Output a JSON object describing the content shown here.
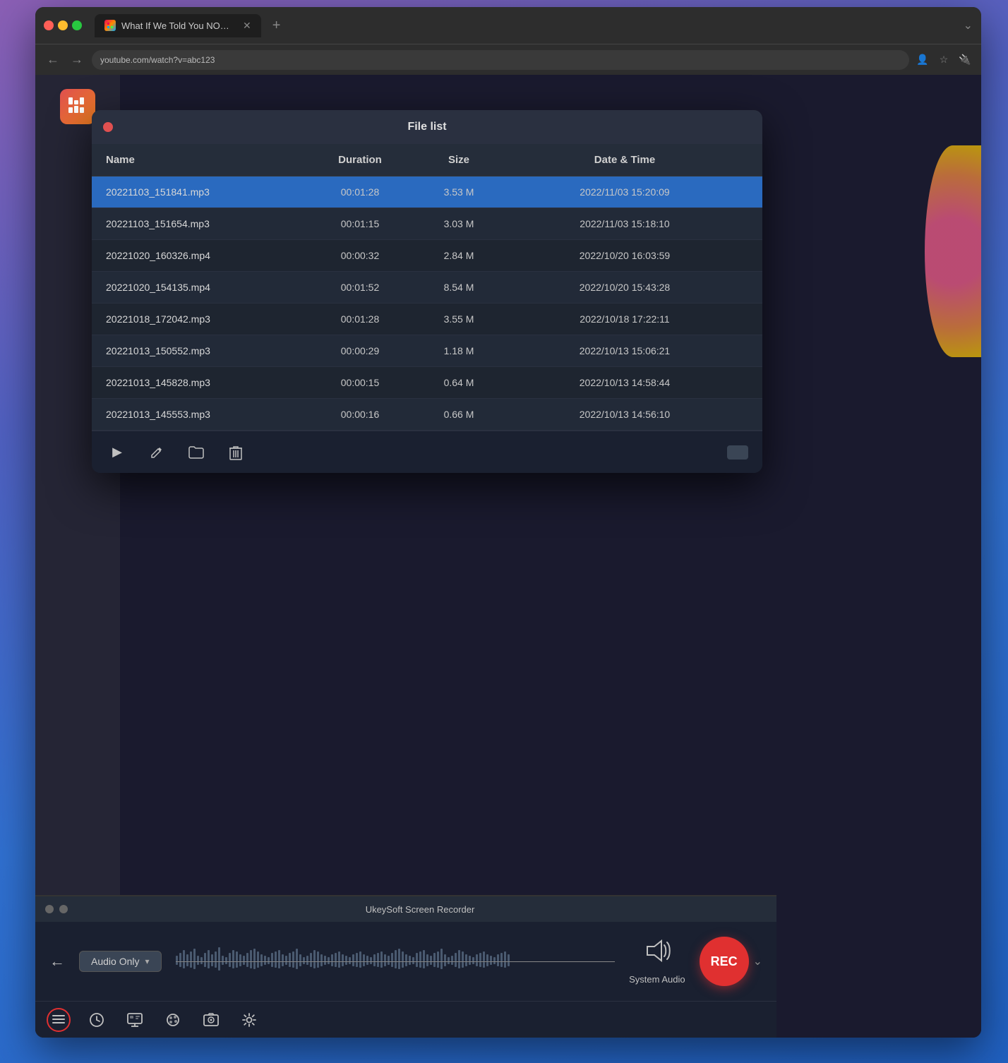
{
  "browser": {
    "tab_title": "What If We Told You NONE Of",
    "tab_new": "+",
    "tab_chevron": "⌄",
    "dots": [
      "red",
      "yellow",
      "green"
    ],
    "nav": {
      "back": "←",
      "forward": "→",
      "address": "youtube.com/watch?v=abc123",
      "reload": "↻"
    }
  },
  "file_list": {
    "title": "File list",
    "close_dot_color": "#e05050",
    "columns": [
      "Name",
      "Duration",
      "Size",
      "Date & Time"
    ],
    "rows": [
      {
        "name": "20221103_151841.mp3",
        "duration": "00:01:28",
        "size": "3.53 M",
        "datetime": "2022/11/03 15:20:09",
        "selected": true
      },
      {
        "name": "20221103_151654.mp3",
        "duration": "00:01:15",
        "size": "3.03 M",
        "datetime": "2022/11/03 15:18:10",
        "selected": false
      },
      {
        "name": "20221020_160326.mp4",
        "duration": "00:00:32",
        "size": "2.84 M",
        "datetime": "2022/10/20 16:03:59",
        "selected": false
      },
      {
        "name": "20221020_154135.mp4",
        "duration": "00:01:52",
        "size": "8.54 M",
        "datetime": "2022/10/20 15:43:28",
        "selected": false
      },
      {
        "name": "20221018_172042.mp3",
        "duration": "00:01:28",
        "size": "3.55 M",
        "datetime": "2022/10/18 17:22:11",
        "selected": false
      },
      {
        "name": "20221013_150552.mp3",
        "duration": "00:00:29",
        "size": "1.18 M",
        "datetime": "2022/10/13 15:06:21",
        "selected": false
      },
      {
        "name": "20221013_145828.mp3",
        "duration": "00:00:15",
        "size": "0.64 M",
        "datetime": "2022/10/13 14:58:44",
        "selected": false
      },
      {
        "name": "20221013_145553.mp3",
        "duration": "00:00:16",
        "size": "0.66 M",
        "datetime": "2022/10/13 14:56:10",
        "selected": false
      }
    ],
    "toolbar": {
      "play": "▶",
      "edit": "✏",
      "folder": "📁",
      "delete": "🗑"
    }
  },
  "recorder": {
    "title": "UkeySoft Screen Recorder",
    "back": "←",
    "mode": "Audio Only",
    "mode_dropdown": "▾",
    "system_audio_label": "System Audio",
    "rec_label": "REC",
    "rec_dropdown": "⌄",
    "dots": [
      "gray",
      "gray"
    ]
  },
  "bottom_bar": {
    "icons": [
      "list",
      "clock",
      "display",
      "palette",
      "image",
      "settings"
    ]
  }
}
